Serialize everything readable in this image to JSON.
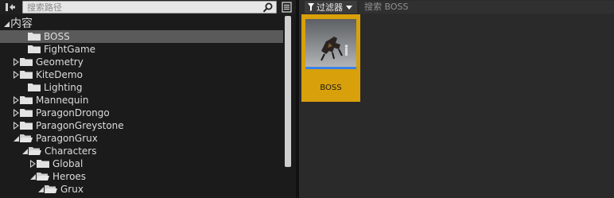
{
  "left": {
    "search_placeholder": "搜索路径",
    "tree": [
      {
        "label": "内容",
        "arrow": "down",
        "open": true,
        "selected": false
      },
      {
        "label": "BOSS",
        "arrow": "none",
        "open": false,
        "selected": true
      },
      {
        "label": "FightGame",
        "arrow": "none",
        "open": false,
        "selected": false
      },
      {
        "label": "Geometry",
        "arrow": "right",
        "open": false,
        "selected": false
      },
      {
        "label": "KiteDemo",
        "arrow": "right",
        "open": false,
        "selected": false
      },
      {
        "label": "Lighting",
        "arrow": "none",
        "open": false,
        "selected": false
      },
      {
        "label": "Mannequin",
        "arrow": "right",
        "open": false,
        "selected": false
      },
      {
        "label": "ParagonDrongo",
        "arrow": "right",
        "open": false,
        "selected": false
      },
      {
        "label": "ParagonGreystone",
        "arrow": "right",
        "open": false,
        "selected": false
      },
      {
        "label": "ParagonGrux",
        "arrow": "down",
        "open": true,
        "selected": false
      },
      {
        "label": "Characters",
        "arrow": "down",
        "open": true,
        "selected": false
      },
      {
        "label": "Global",
        "arrow": "right",
        "open": false,
        "selected": false
      },
      {
        "label": "Heroes",
        "arrow": "down",
        "open": true,
        "selected": false
      },
      {
        "label": "Grux",
        "arrow": "down",
        "open": true,
        "selected": false
      }
    ]
  },
  "right": {
    "filter_label": "过滤器",
    "search_placeholder": "搜索 BOSS",
    "asset": {
      "label": "BOSS",
      "selected": true
    }
  },
  "colors": {
    "selected_row": "#5a5a5a",
    "asset_highlight": "#d8a00a",
    "thumbnail_bar": "#3b82e8"
  }
}
